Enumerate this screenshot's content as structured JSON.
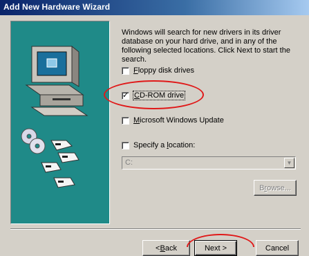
{
  "window": {
    "title": "Add New Hardware Wizard"
  },
  "description": "Windows will search for new drivers in its driver database on your hard drive, and in any of the following selected locations. Click Next to start the search.",
  "options": {
    "floppy": {
      "label_u": "F",
      "label_rest": "loppy disk drives",
      "checked": false
    },
    "cdrom": {
      "label_u": "C",
      "label_rest": "D-ROM drive",
      "checked": true
    },
    "windows_update": {
      "label_u": "M",
      "label_rest": "icrosoft Windows Update",
      "checked": false
    },
    "location": {
      "label_pre": "Specify a ",
      "label_u": "l",
      "label_rest": "ocation:",
      "checked": false
    }
  },
  "location_combo": {
    "value": "C:"
  },
  "buttons": {
    "browse": {
      "pre": "B",
      "u": "r",
      "rest": "owse..."
    },
    "back": {
      "pre": "< ",
      "u": "B",
      "rest": "ack"
    },
    "next": "Next >",
    "cancel": "Cancel"
  },
  "checkmark": "✓",
  "annotation_color": "#e01818"
}
